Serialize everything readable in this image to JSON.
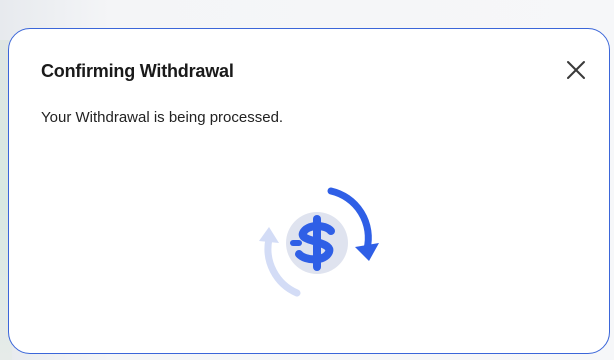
{
  "dialog": {
    "title": "Confirming Withdrawal",
    "message": "Your Withdrawal is being processed.",
    "close_icon": "close-icon",
    "graphic_icon": "dollar-exchange-icon"
  },
  "colors": {
    "accent": "#3b66d9",
    "icon_blue": "#2f5fe6",
    "icon_circle": "#dfe3ef",
    "icon_faint": "#cfd9f7"
  }
}
